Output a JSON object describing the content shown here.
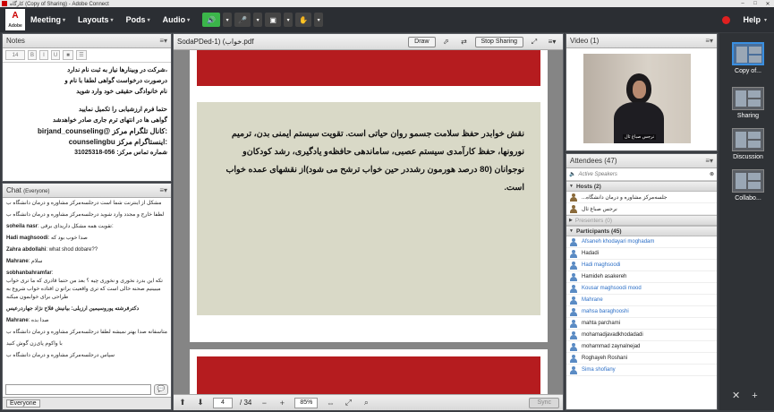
{
  "window": {
    "title": "کارگاه (Copy of Sharing) - Adobe Connect"
  },
  "menu": {
    "logo": "Adobe",
    "items": [
      "Meeting",
      "Layouts",
      "Pods",
      "Audio"
    ],
    "help": "Help",
    "colors": {
      "speaker_active": "#3bb54a",
      "record": "#e02020"
    }
  },
  "notes": {
    "title": "Notes",
    "font_size": "14",
    "lines": [
      "،شرکت در وبینارها نیاز به ثبت نام ندارد",
      "درصورت درخواست گواهی لطفا با نام و",
      "نام خانوادگی حقیقی خود وارد شوید",
      "حتما فرم ارزشیابی را تکمیل نمایید",
      "گواهی ها در انتهای ترم جاری صادر خواهدشد",
      ":کانال تلگرام مرکز @birjand_counseling",
      ":اینستاگرام مرکز counselingbu",
      "شماره تماس مرکز: 056-31025318"
    ]
  },
  "chat": {
    "title": "Chat",
    "scope": "(Everyone)",
    "messages": [
      {
        "who": "",
        "text": "مشکل از اینترنت شما است در‌جلسه‌مرکز مشاوره و درمان دانشگاه ب"
      },
      {
        "who": "",
        "text": "لطفا خارج و مجدد وارد شوید در‌جلسه‌مرکز مشاوره و درمان دانشگاه ب"
      },
      {
        "who": "soheila nasr",
        "text": "تقویت همه مشکل داریدای برقی:"
      },
      {
        "who": "Hadi maghsoodi",
        "text": "صدا خوب بود که"
      },
      {
        "who": "Zahra abdollahi",
        "text": "what shod dobare??"
      },
      {
        "who": "Mahrane",
        "text": "سلام"
      },
      {
        "who": "sobhanbahramfar",
        "text": "تکه این بدرد نخوری و نخوری چیه ؟ بعد من حتما قادری که ما تری خواب میبینیم صحنه خالی است که تری واقعیت براتو ن افتاده خواب شروع به طراحی برای خوابمون میکنه"
      },
      {
        "who": "",
        "text": "دکترفرشته‌ پورو‌سیمین ارزیلی: بیانیش فلاح نژاد جهاردرعیس"
      },
      {
        "who": "Mahrane",
        "text": "صدا بده"
      },
      {
        "who": "",
        "text": "متاسفانه صدا بهتر نمیشه لطفا در‌جلسه‌مرکز مشاوره و درمان دانشگاه ب"
      },
      {
        "who": "",
        "text": "با واکوم پای‌زن گوش کنید"
      },
      {
        "who": "",
        "text": "سپاس در‌جلسه‌مرکز مشاوره و درمان دانشگاه ب"
      }
    ],
    "footer": "Everyone"
  },
  "share": {
    "file": "SodaPDed-1) (خواب.pdf",
    "draw": "Draw",
    "stop": "Stop Sharing",
    "paragraph": "نقش خوابدر حفظ سلامت جسمو روان حیاتی است. تقویت سیستم ایمنی بدن، ترمیم نورونها، حفظ کارآمدی سیستم عصبی، ساماندهی حافظه‌و یادگیری، رشد کودکان‌و نوجوانان (80 درصد هورمون رشددر حین خواب ترشح می شود)از نقشهای عمده خواب است.",
    "page_current": "4",
    "page_total": "/ 34",
    "zoom": "85%",
    "sync": "Sync",
    "colors": {
      "banner": "#b51c1f",
      "box": "#d9d9c7"
    }
  },
  "video": {
    "title": "Video",
    "count": "(1)",
    "name_tag": "نرجس صباغ ثال"
  },
  "attendees": {
    "title": "Attendees",
    "count": "(47)",
    "speakers_label": "Active Speakers",
    "hosts_label": "Hosts (2)",
    "hosts": [
      "جلسه‌مرکز مشاوره و درمان دانشگاه...",
      "نرجس صباغ ثال"
    ],
    "presenters_label": "Presenters (0)",
    "participants_label": "Participants (45)",
    "participants": [
      {
        "name": "Afsaneh khodayari moghadam",
        "blue": true
      },
      {
        "name": "Hadadi",
        "blue": false
      },
      {
        "name": "Hadi maghsoodi",
        "blue": true
      },
      {
        "name": "Hamideh asakereh",
        "blue": false
      },
      {
        "name": "Kousar maghsoodi mood",
        "blue": true
      },
      {
        "name": "Mahrane",
        "blue": true
      },
      {
        "name": "mahsa baraghooshi",
        "blue": true
      },
      {
        "name": "mahta parchami",
        "blue": false
      },
      {
        "name": "mohamadjavadkhodadadi",
        "blue": false
      },
      {
        "name": "mohammad zaynalnejad",
        "blue": false
      },
      {
        "name": "Roghayeh Roshani",
        "blue": false
      },
      {
        "name": "Sima shofiany",
        "blue": true
      }
    ]
  },
  "rail": {
    "items": [
      "Copy of...",
      "Sharing",
      "Discussion",
      "Collabo..."
    ]
  }
}
